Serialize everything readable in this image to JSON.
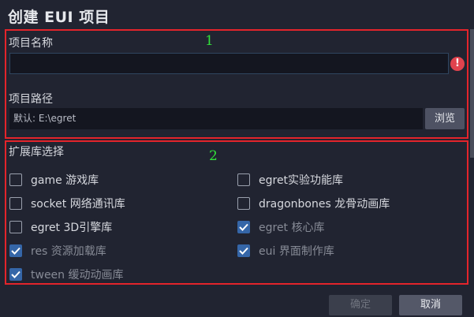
{
  "dialog": {
    "title": "创建 EUI 项目"
  },
  "annotations": {
    "box1_label": "1",
    "box2_label": "2",
    "box_color": "#e3242b",
    "label_color": "#32e03a"
  },
  "project": {
    "name_label": "项目名称",
    "name_value": "",
    "name_error_icon": "error-icon",
    "path_label": "项目路径",
    "path_value": "默认: E:\\egret",
    "browse_label": "浏览"
  },
  "libraries": {
    "heading": "扩展库选择",
    "items": [
      {
        "label": "game 游戏库",
        "checked": false,
        "disabled": false
      },
      {
        "label": "egret实验功能库",
        "checked": false,
        "disabled": false
      },
      {
        "label": "socket 网络通讯库",
        "checked": false,
        "disabled": false
      },
      {
        "label": "dragonbones 龙骨动画库",
        "checked": false,
        "disabled": false
      },
      {
        "label": "egret 3D引擎库",
        "checked": false,
        "disabled": false
      },
      {
        "label": "egret 核心库",
        "checked": true,
        "disabled": true
      },
      {
        "label": "res 资源加载库",
        "checked": true,
        "disabled": true
      },
      {
        "label": "eui 界面制作库",
        "checked": true,
        "disabled": true
      },
      {
        "label": "tween 缓动动画库",
        "checked": true,
        "disabled": true
      }
    ]
  },
  "footer": {
    "ok_label": "确定",
    "ok_disabled": true,
    "cancel_label": "取消"
  }
}
